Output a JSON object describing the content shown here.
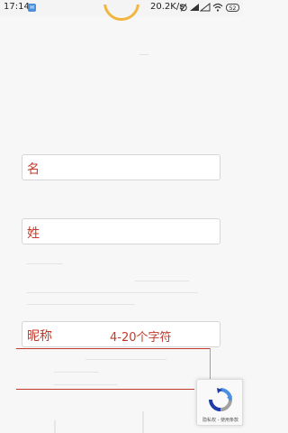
{
  "status_bar": {
    "time": "17:14",
    "app_icon_glyph": "✉",
    "network_speed": "20.2K/s",
    "battery_level": "52",
    "icons": [
      "notification-icon",
      "alarm-icon",
      "signal-icon",
      "signal-icon",
      "wifi-icon",
      "battery-icon"
    ]
  },
  "form": {
    "first_name_label": "名",
    "last_name_label": "姓",
    "nickname_label": "昵称",
    "nickname_hint": "4-20个字符"
  },
  "recaptcha": {
    "links": "隐私权 - 使用条款"
  },
  "colors": {
    "accent_red": "#c23a2b",
    "logo_yellow": "#f2b640",
    "background": "#f7f7f7"
  }
}
